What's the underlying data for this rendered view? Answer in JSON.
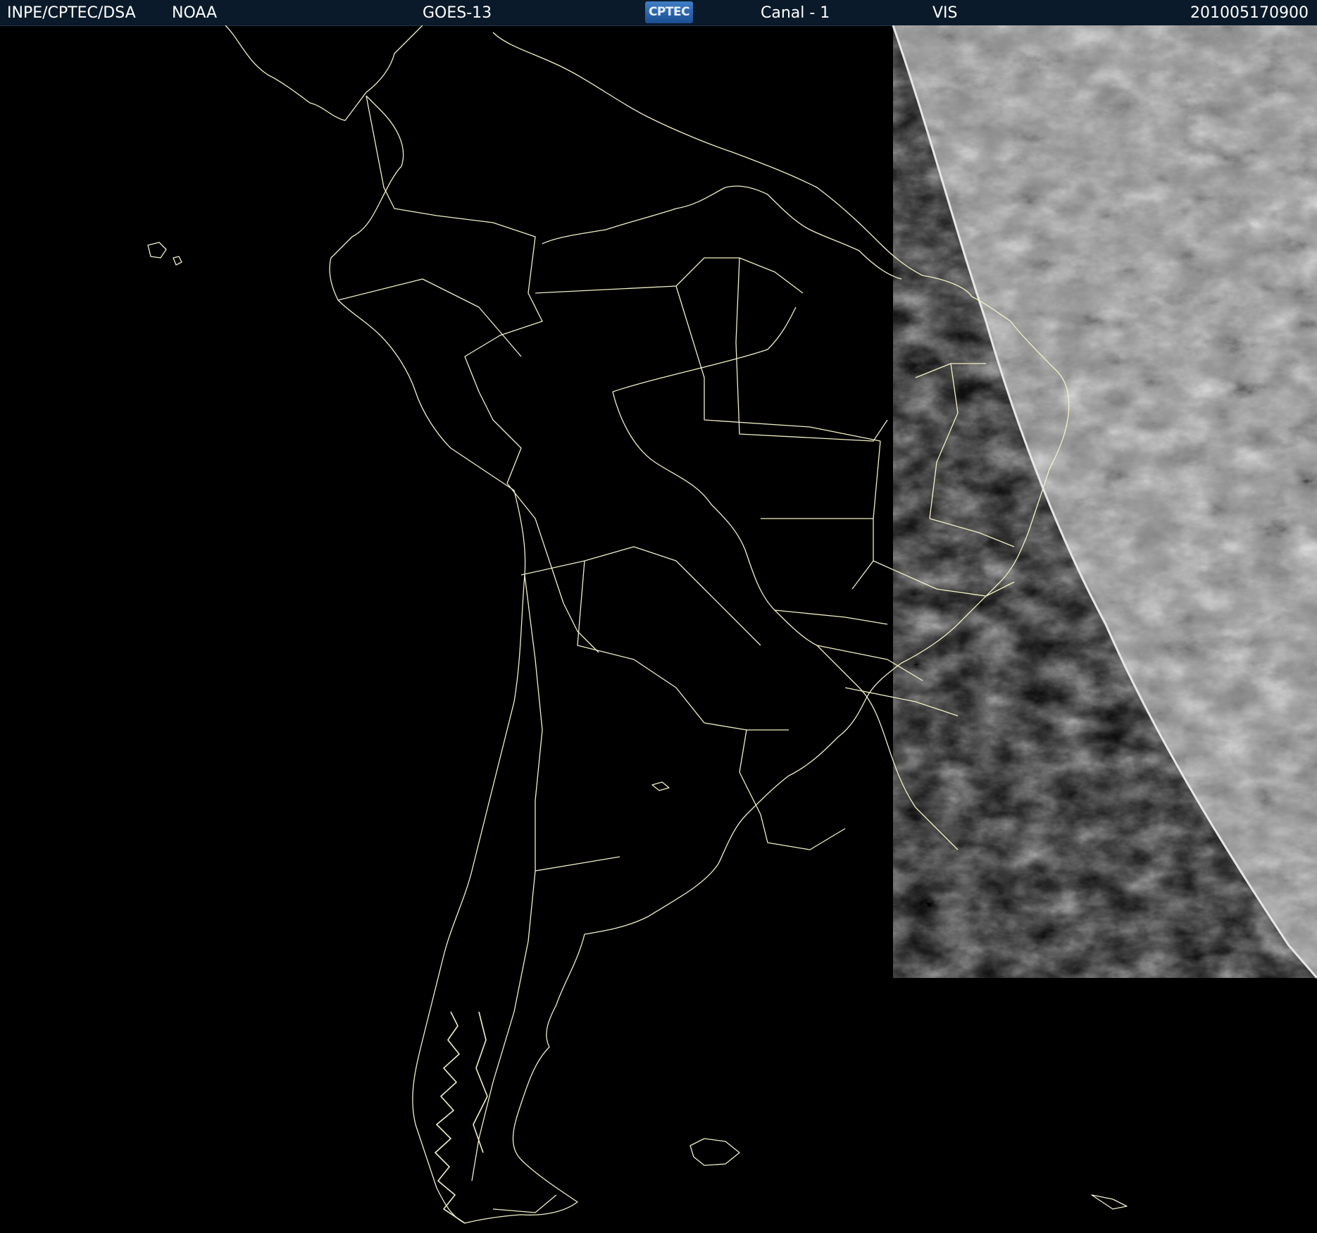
{
  "header": {
    "institution": "INPE/CPTEC/DSA",
    "agency": "NOAA",
    "satellite": "GOES-13",
    "logo_text": "CPTEC",
    "channel": "Canal - 1",
    "band": "VIS",
    "timestamp": "201005170900"
  },
  "colors": {
    "header_bg": "#0b1a2a",
    "header_text": "#ffffff",
    "map_background": "#000000",
    "border_lines": "#f2f0c4",
    "cloud_gray": "#9a9a9a"
  },
  "map": {
    "projection_region": "South America",
    "illuminated_region": "east (daylight terminator)"
  }
}
